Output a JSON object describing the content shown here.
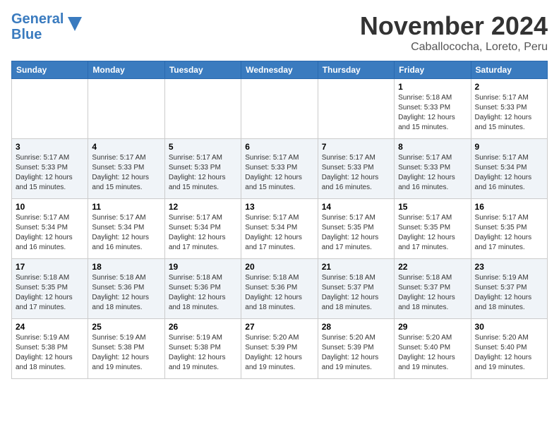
{
  "logo": {
    "line1": "General",
    "line2": "Blue"
  },
  "title": "November 2024",
  "location": "Caballococha, Loreto, Peru",
  "weekdays": [
    "Sunday",
    "Monday",
    "Tuesday",
    "Wednesday",
    "Thursday",
    "Friday",
    "Saturday"
  ],
  "weeks": [
    [
      {
        "day": "",
        "info": ""
      },
      {
        "day": "",
        "info": ""
      },
      {
        "day": "",
        "info": ""
      },
      {
        "day": "",
        "info": ""
      },
      {
        "day": "",
        "info": ""
      },
      {
        "day": "1",
        "info": "Sunrise: 5:18 AM\nSunset: 5:33 PM\nDaylight: 12 hours\nand 15 minutes."
      },
      {
        "day": "2",
        "info": "Sunrise: 5:17 AM\nSunset: 5:33 PM\nDaylight: 12 hours\nand 15 minutes."
      }
    ],
    [
      {
        "day": "3",
        "info": "Sunrise: 5:17 AM\nSunset: 5:33 PM\nDaylight: 12 hours\nand 15 minutes."
      },
      {
        "day": "4",
        "info": "Sunrise: 5:17 AM\nSunset: 5:33 PM\nDaylight: 12 hours\nand 15 minutes."
      },
      {
        "day": "5",
        "info": "Sunrise: 5:17 AM\nSunset: 5:33 PM\nDaylight: 12 hours\nand 15 minutes."
      },
      {
        "day": "6",
        "info": "Sunrise: 5:17 AM\nSunset: 5:33 PM\nDaylight: 12 hours\nand 15 minutes."
      },
      {
        "day": "7",
        "info": "Sunrise: 5:17 AM\nSunset: 5:33 PM\nDaylight: 12 hours\nand 16 minutes."
      },
      {
        "day": "8",
        "info": "Sunrise: 5:17 AM\nSunset: 5:33 PM\nDaylight: 12 hours\nand 16 minutes."
      },
      {
        "day": "9",
        "info": "Sunrise: 5:17 AM\nSunset: 5:34 PM\nDaylight: 12 hours\nand 16 minutes."
      }
    ],
    [
      {
        "day": "10",
        "info": "Sunrise: 5:17 AM\nSunset: 5:34 PM\nDaylight: 12 hours\nand 16 minutes."
      },
      {
        "day": "11",
        "info": "Sunrise: 5:17 AM\nSunset: 5:34 PM\nDaylight: 12 hours\nand 16 minutes."
      },
      {
        "day": "12",
        "info": "Sunrise: 5:17 AM\nSunset: 5:34 PM\nDaylight: 12 hours\nand 17 minutes."
      },
      {
        "day": "13",
        "info": "Sunrise: 5:17 AM\nSunset: 5:34 PM\nDaylight: 12 hours\nand 17 minutes."
      },
      {
        "day": "14",
        "info": "Sunrise: 5:17 AM\nSunset: 5:35 PM\nDaylight: 12 hours\nand 17 minutes."
      },
      {
        "day": "15",
        "info": "Sunrise: 5:17 AM\nSunset: 5:35 PM\nDaylight: 12 hours\nand 17 minutes."
      },
      {
        "day": "16",
        "info": "Sunrise: 5:17 AM\nSunset: 5:35 PM\nDaylight: 12 hours\nand 17 minutes."
      }
    ],
    [
      {
        "day": "17",
        "info": "Sunrise: 5:18 AM\nSunset: 5:35 PM\nDaylight: 12 hours\nand 17 minutes."
      },
      {
        "day": "18",
        "info": "Sunrise: 5:18 AM\nSunset: 5:36 PM\nDaylight: 12 hours\nand 18 minutes."
      },
      {
        "day": "19",
        "info": "Sunrise: 5:18 AM\nSunset: 5:36 PM\nDaylight: 12 hours\nand 18 minutes."
      },
      {
        "day": "20",
        "info": "Sunrise: 5:18 AM\nSunset: 5:36 PM\nDaylight: 12 hours\nand 18 minutes."
      },
      {
        "day": "21",
        "info": "Sunrise: 5:18 AM\nSunset: 5:37 PM\nDaylight: 12 hours\nand 18 minutes."
      },
      {
        "day": "22",
        "info": "Sunrise: 5:18 AM\nSunset: 5:37 PM\nDaylight: 12 hours\nand 18 minutes."
      },
      {
        "day": "23",
        "info": "Sunrise: 5:19 AM\nSunset: 5:37 PM\nDaylight: 12 hours\nand 18 minutes."
      }
    ],
    [
      {
        "day": "24",
        "info": "Sunrise: 5:19 AM\nSunset: 5:38 PM\nDaylight: 12 hours\nand 18 minutes."
      },
      {
        "day": "25",
        "info": "Sunrise: 5:19 AM\nSunset: 5:38 PM\nDaylight: 12 hours\nand 19 minutes."
      },
      {
        "day": "26",
        "info": "Sunrise: 5:19 AM\nSunset: 5:38 PM\nDaylight: 12 hours\nand 19 minutes."
      },
      {
        "day": "27",
        "info": "Sunrise: 5:20 AM\nSunset: 5:39 PM\nDaylight: 12 hours\nand 19 minutes."
      },
      {
        "day": "28",
        "info": "Sunrise: 5:20 AM\nSunset: 5:39 PM\nDaylight: 12 hours\nand 19 minutes."
      },
      {
        "day": "29",
        "info": "Sunrise: 5:20 AM\nSunset: 5:40 PM\nDaylight: 12 hours\nand 19 minutes."
      },
      {
        "day": "30",
        "info": "Sunrise: 5:20 AM\nSunset: 5:40 PM\nDaylight: 12 hours\nand 19 minutes."
      }
    ]
  ]
}
